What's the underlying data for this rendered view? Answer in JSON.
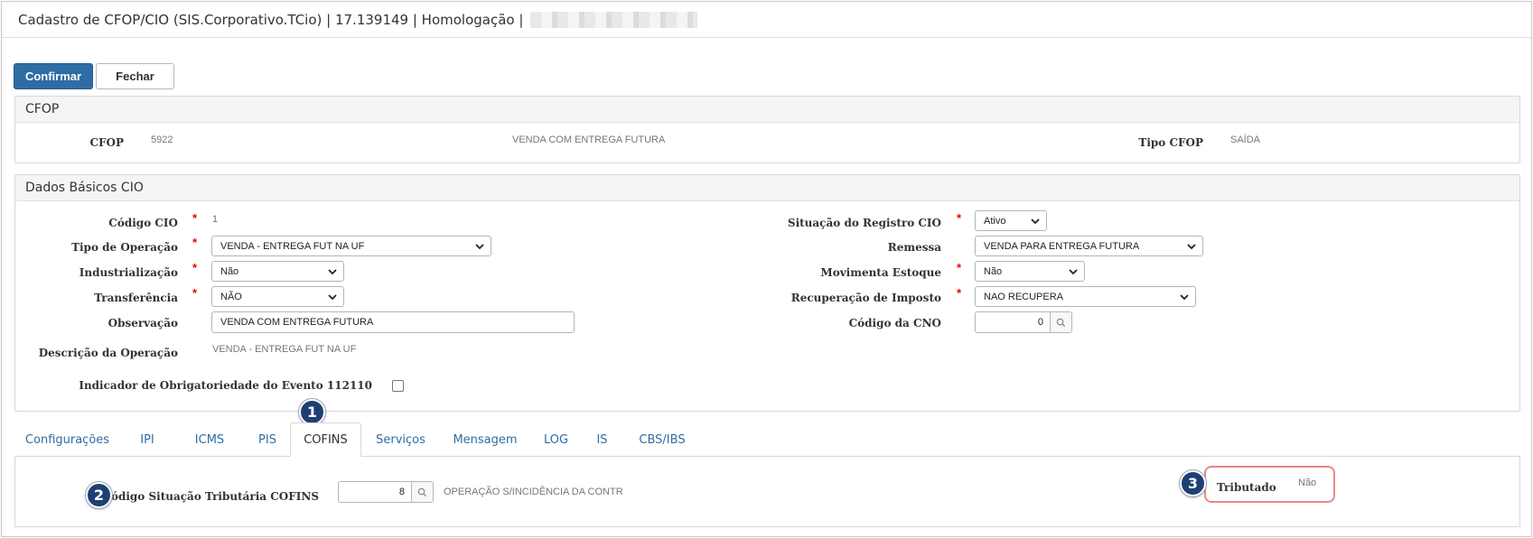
{
  "window": {
    "title": "Cadastro de CFOP/CIO (SIS.Corporativo.TCio) | 17.139149 | Homologação |"
  },
  "toolbar": {
    "confirm_label": "Confirmar",
    "close_label": "Fechar"
  },
  "cfop_panel": {
    "title": "CFOP",
    "cfop_label": "CFOP",
    "cfop_code": "5922",
    "cfop_description": "VENDA COM ENTREGA FUTURA",
    "tipo_label": "Tipo CFOP",
    "tipo_value": "SAÍDA"
  },
  "cio_panel": {
    "title": "Dados Básicos CIO",
    "codigo_label": "Código CIO",
    "codigo_value": "1",
    "tipo_operacao_label": "Tipo de Operação",
    "tipo_operacao_value": "VENDA - ENTREGA FUT NA UF",
    "industrializacao_label": "Industrialização",
    "industrializacao_value": "Não",
    "transferencia_label": "Transferência",
    "transferencia_value": "NÃO",
    "observacao_label": "Observação",
    "observacao_value": "VENDA COM ENTREGA FUTURA",
    "descricao_label": "Descrição da Operação",
    "descricao_value": "VENDA - ENTREGA FUT NA UF",
    "indicador_label": "Indicador de Obrigatoriedade do Evento 112110",
    "indicador_checked": false,
    "situacao_label": "Situação do Registro CIO",
    "situacao_value": "Ativo",
    "remessa_label": "Remessa",
    "remessa_value": "VENDA PARA ENTREGA FUTURA",
    "movimenta_label": "Movimenta Estoque",
    "movimenta_value": "Não",
    "recuperacao_label": "Recuperação de Imposto",
    "recuperacao_value": "NAO RECUPERA",
    "cno_label": "Código da CNO",
    "cno_value": "0"
  },
  "tabs": [
    {
      "label": "Configurações"
    },
    {
      "label": "IPI"
    },
    {
      "label": "ICMS"
    },
    {
      "label": "PIS"
    },
    {
      "label": "COFINS",
      "active": true
    },
    {
      "label": "Serviços"
    },
    {
      "label": "Mensagem"
    },
    {
      "label": "LOG"
    },
    {
      "label": "IS"
    },
    {
      "label": "CBS/IBS"
    }
  ],
  "cofins_tab": {
    "cst_label": "Código Situação Tributária COFINS",
    "cst_value": "8",
    "cst_description": "OPERAÇÃO S/INCIDÊNCIA DA CONTR",
    "tributado_label": "Tributado",
    "tributado_value": "Não"
  },
  "callouts": {
    "one": "1",
    "two": "2",
    "three": "3"
  },
  "colors": {
    "primary": "#2e6da4",
    "required": "#e00000",
    "callout": "#1f3f73",
    "highlight": "#e8888a"
  }
}
